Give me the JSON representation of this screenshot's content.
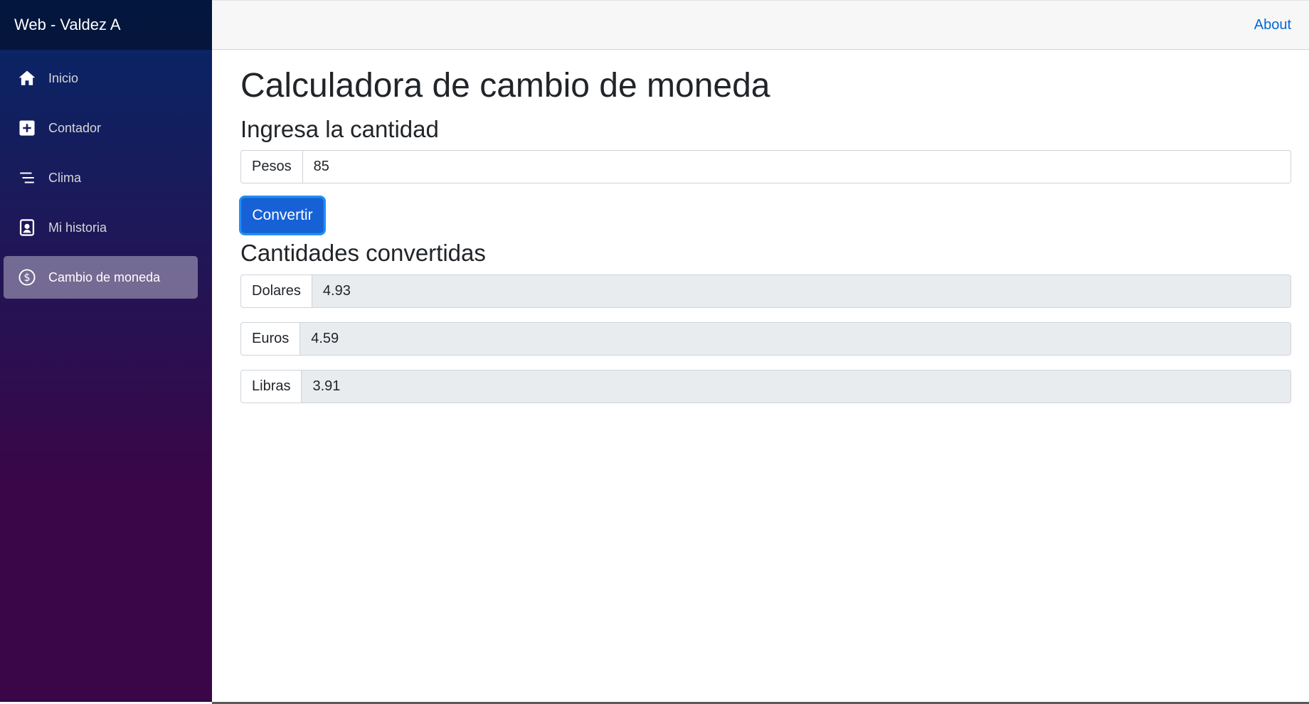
{
  "brand": "Web - Valdez A",
  "sidebar": {
    "items": [
      {
        "label": "Inicio",
        "icon": "home-icon"
      },
      {
        "label": "Contador",
        "icon": "plus-icon"
      },
      {
        "label": "Clima",
        "icon": "list-icon"
      },
      {
        "label": "Mi historia",
        "icon": "person-badge-icon"
      },
      {
        "label": "Cambio de moneda",
        "icon": "currency-dollar-icon",
        "active": true
      }
    ]
  },
  "topbar": {
    "about_label": "About"
  },
  "page": {
    "title": "Calculadora de cambio de moneda",
    "input_heading": "Ingresa la cantidad",
    "input": {
      "label": "Pesos",
      "value": "85"
    },
    "convert_button": "Convertir",
    "results_heading": "Cantidades convertidas",
    "results": [
      {
        "label": "Dolares",
        "value": "4.93"
      },
      {
        "label": "Euros",
        "value": "4.59"
      },
      {
        "label": "Libras",
        "value": "3.91"
      }
    ]
  },
  "colors": {
    "accent": "#1661d6",
    "link": "#0366d6",
    "sidebar_top": "#052767",
    "sidebar_bottom": "#3a0647"
  }
}
